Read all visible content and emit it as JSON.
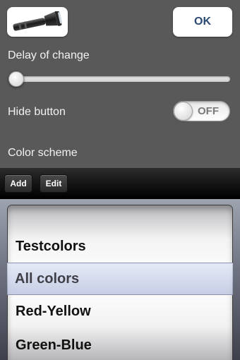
{
  "header": {
    "thumbnail_icon": "flashlight-icon",
    "ok_label": "OK"
  },
  "settings": {
    "delay_label": "Delay of change",
    "delay_value": 0,
    "hide_button_label": "Hide button",
    "hide_button_state": "OFF",
    "color_scheme_label": "Color scheme"
  },
  "toolbar": {
    "add_label": "Add",
    "edit_label": "Edit"
  },
  "picker": {
    "items": [
      "Testcolors",
      "All colors",
      "Red-Yellow",
      "Green-Blue"
    ],
    "selected": "All colors"
  },
  "colors": {
    "ok_text": "#2c4a73",
    "background": "#595959",
    "selection": "#c8cfe6"
  }
}
